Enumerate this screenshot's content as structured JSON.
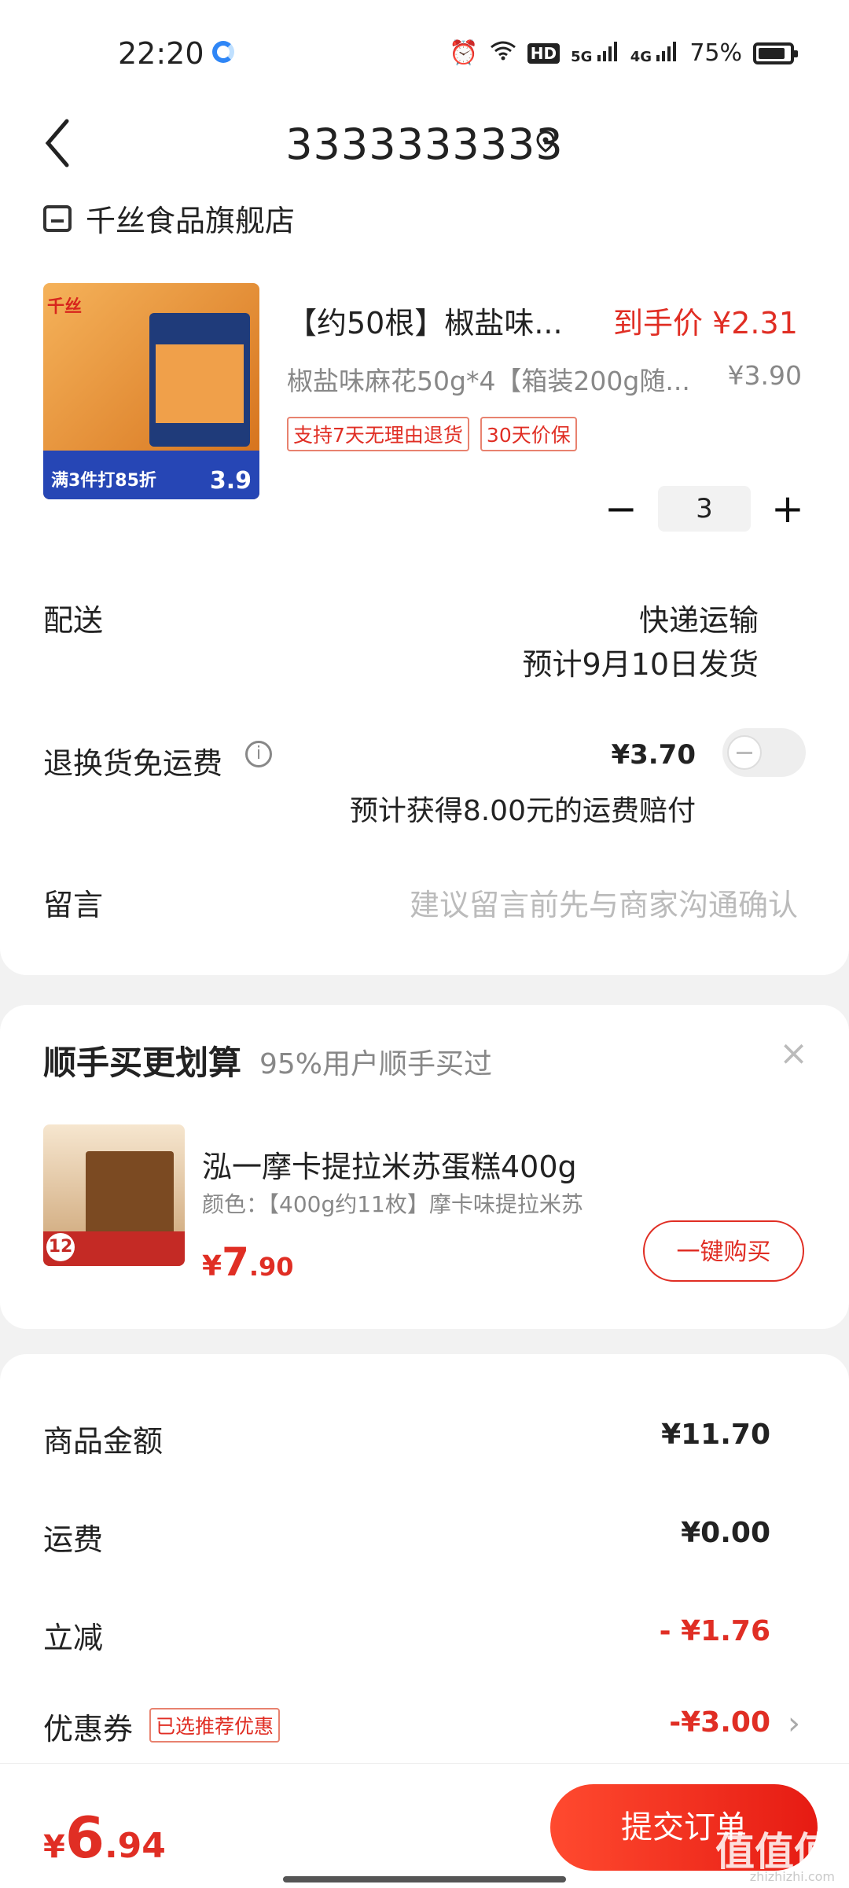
{
  "status_bar": {
    "time": "22:20",
    "alarm_icon": "alarm-icon",
    "wifi_icon": "wifi-icon",
    "hd_label": "HD",
    "net1": "5G",
    "net2": "4G",
    "battery": "75%"
  },
  "header": {
    "address": "3333333333",
    "back_icon": "chevron-left-icon",
    "location_icon": "location-pin-icon"
  },
  "store": {
    "name": "千丝食品旗舰店"
  },
  "product": {
    "title": "【约50根】椒盐味...",
    "final_price_label": "到手价 ¥2.31",
    "spec": "椒盐味麻花50g*4【箱装200g随...",
    "original_price": "¥3.90",
    "badges": [
      "支持7天无理由退货",
      "30天价保"
    ],
    "image_banner_text": "满3件打85折",
    "image_price": "3.9",
    "image_logo": "千丝",
    "quantity": "3",
    "minus": "−",
    "plus": "+"
  },
  "delivery": {
    "label": "配送",
    "method": "快递运输",
    "date": "预计9月10日发货"
  },
  "return_fee": {
    "label": "退换货免运费",
    "price": "¥3.70",
    "note": "预计获得8.00元的运费赔付",
    "enabled": false
  },
  "message": {
    "label": "留言",
    "placeholder": "建议留言前先与商家沟通确认"
  },
  "upsell": {
    "title": "顺手买更划算",
    "subtitle": "95%用户顺手买过",
    "close": "×",
    "name": "泓一摩卡提拉米苏蛋糕400g",
    "spec": "颜色：【400g约11枚】摩卡味提拉米苏",
    "price_currency": "¥",
    "price_int": "7",
    "price_dec": ".90",
    "image_count": "12",
    "buy_button": "一键购买"
  },
  "summary": {
    "goods_label": "商品金额",
    "goods_value": "¥11.70",
    "shipping_label": "运费",
    "shipping_value": "¥0.00",
    "discount_label": "立减",
    "discount_value": "- ¥1.76",
    "coupon_label": "优惠券",
    "coupon_badge": "已选推荐优惠",
    "coupon_value": "-¥3.00",
    "chevron": "›"
  },
  "bottom": {
    "currency": "¥",
    "total_int": "6",
    "total_dec": ".94",
    "submit": "提交订单",
    "watermark": "值值值",
    "watermark_sub": "zhizhizhi.com"
  },
  "colors": {
    "accent": "#e02e24",
    "button_gradient_start": "#ff4a2f",
    "button_gradient_end": "#e61b13"
  }
}
